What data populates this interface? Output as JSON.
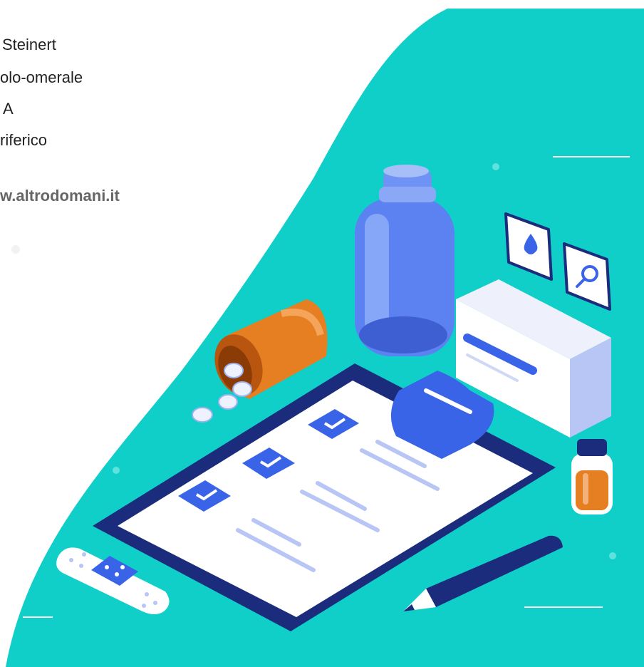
{
  "text_lines": [
    "Steinert",
    "olo-omerale",
    "A",
    "riferico"
  ],
  "link_text": "w.altrodomani.it",
  "colors": {
    "teal": "#0fcfc8",
    "navy": "#1c2c7d",
    "blue": "#3a64e8",
    "light_blue": "#b7c6f5",
    "orange": "#e67e22"
  },
  "illustration_items": [
    "medicine-bottle",
    "pill-bottle",
    "clipboard-checklist",
    "medicine-box",
    "vial",
    "bandage",
    "pen",
    "drop-icon",
    "search-icon"
  ]
}
